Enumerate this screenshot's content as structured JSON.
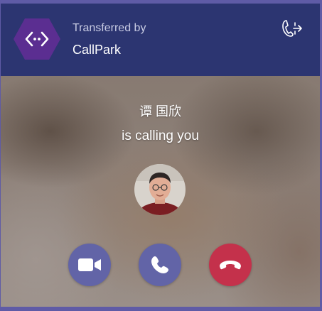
{
  "header": {
    "subtitle": "Transferred by",
    "title": "CallPark",
    "logo_icon": "code-hexagon-icon",
    "action_icon": "transfer-call-icon"
  },
  "caller": {
    "name": "谭 国欣",
    "status": "is calling you",
    "avatar": "caller-photo"
  },
  "actions": {
    "video": "video-camera-icon",
    "audio": "phone-icon",
    "decline": "hang-up-icon"
  },
  "colors": {
    "header_bg": "#2c3571",
    "accent": "#6264a7",
    "decline": "#c4314b",
    "logo": "#5b2e91"
  }
}
